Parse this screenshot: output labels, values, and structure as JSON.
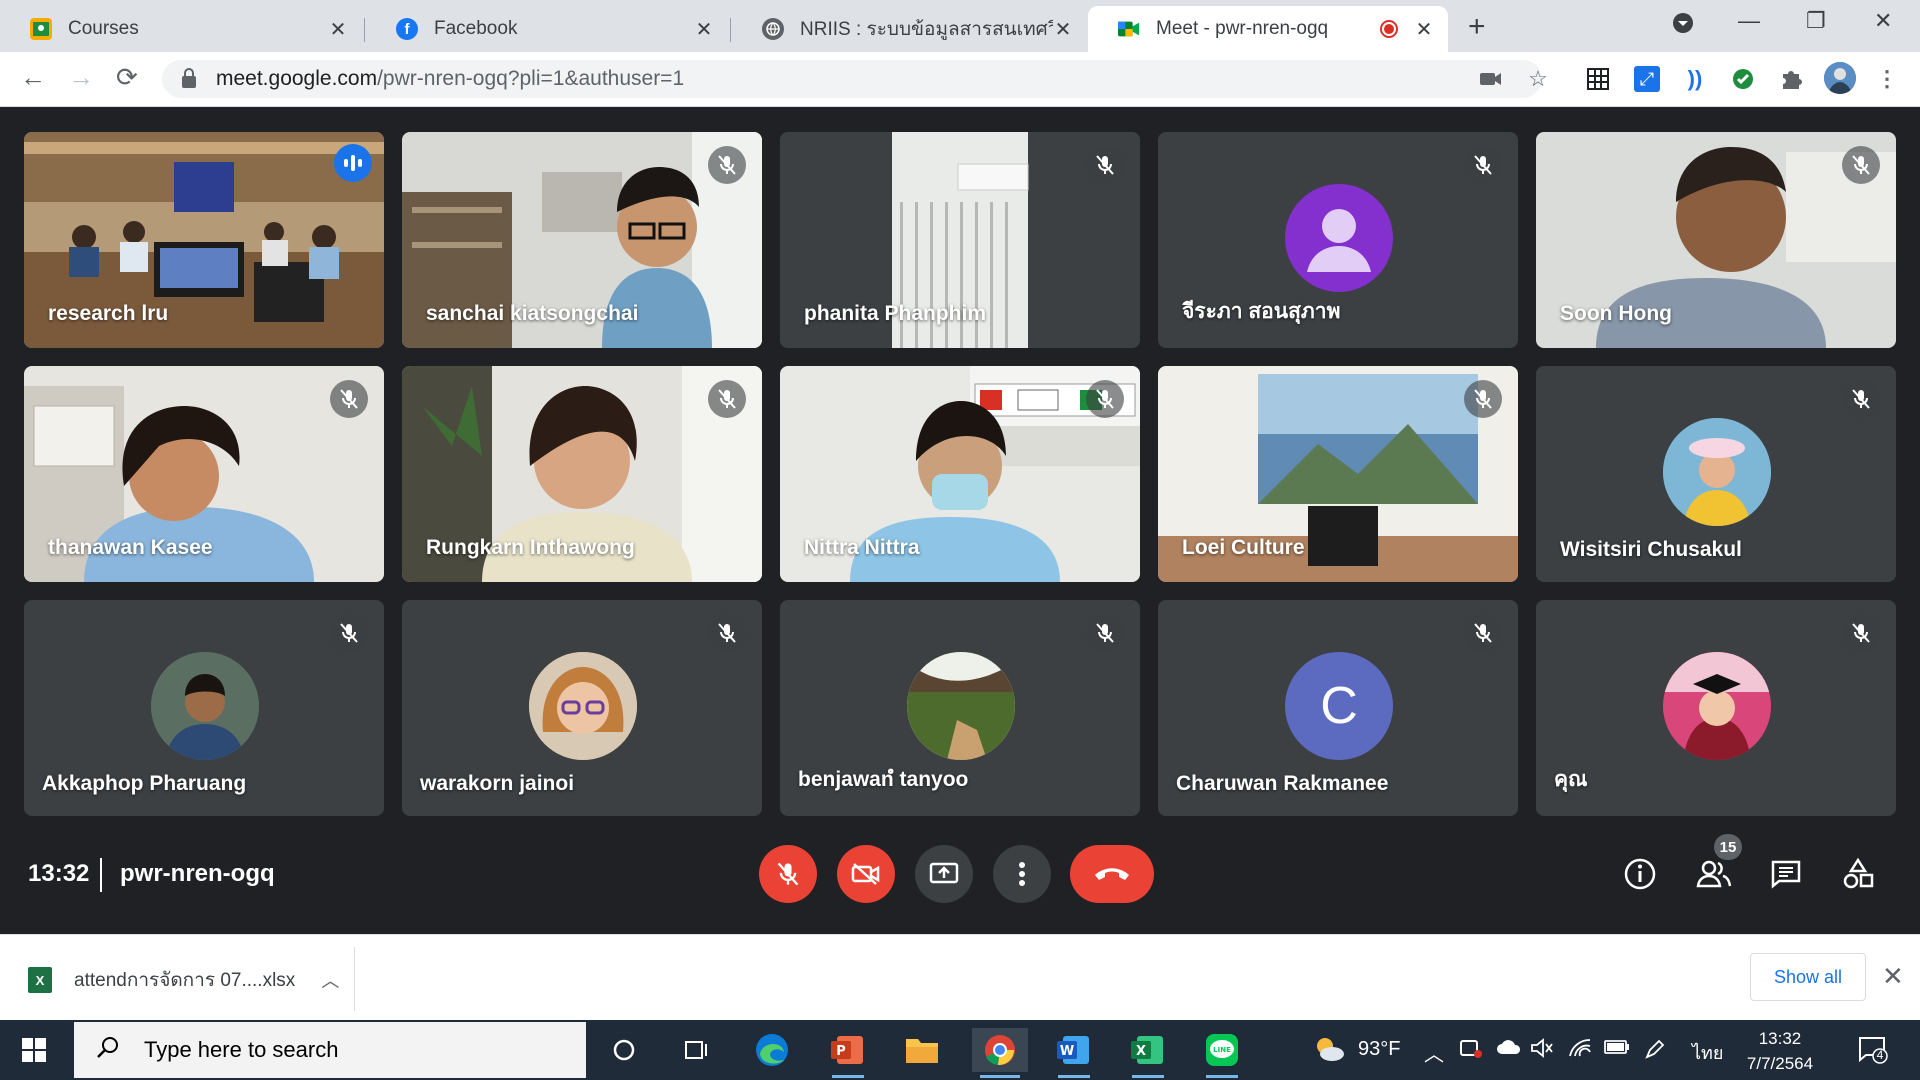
{
  "browser": {
    "tabs": [
      {
        "title": "Courses",
        "icon": "google-classroom-icon"
      },
      {
        "title": "Facebook",
        "icon": "facebook-icon"
      },
      {
        "title": "NRIIS : ระบบข้อมูลสารสนเทศวิจัยและ",
        "icon": "globe-icon"
      },
      {
        "title": "Meet - pwr-nren-ogq",
        "icon": "google-meet-icon",
        "active": true,
        "recording": true
      }
    ],
    "address": {
      "host": "meet.google.com",
      "path": "/pwr-nren-ogq?pli=1&authuser=1"
    }
  },
  "participants": [
    {
      "name": "research lru",
      "talking": true
    },
    {
      "name": "sanchai kiatsongchai",
      "muted": true
    },
    {
      "name": "phanita Phanphim",
      "muted": true
    },
    {
      "name": "จีระภา สอนสุภาพ",
      "muted": true,
      "avatar": "default-person"
    },
    {
      "name": "Soon Hong",
      "muted": true
    },
    {
      "name": "thanawan Kasee",
      "muted": true
    },
    {
      "name": "Rungkarn Inthawong",
      "muted": true
    },
    {
      "name": "Nittra Nittra",
      "muted": true
    },
    {
      "name": "Loei Culture",
      "muted": true
    },
    {
      "name": "Wisitsiri Chusakul",
      "muted": true,
      "avatar": "photo"
    },
    {
      "name": "Akkaphop Pharuang",
      "muted": true,
      "avatar": "photo"
    },
    {
      "name": "warakorn jainoi",
      "muted": true,
      "avatar": "photo"
    },
    {
      "name": "benjawanํ tanyoo",
      "muted": true,
      "avatar": "photo"
    },
    {
      "name": "Charuwan Rakmanee",
      "muted": true,
      "avatar_letter": "C"
    },
    {
      "name": "คุณ",
      "muted": true,
      "avatar": "photo"
    }
  ],
  "meeting": {
    "time": "13:32",
    "code": "pwr-nren-ogq",
    "people_count": "15"
  },
  "downloads": {
    "file_name": "attendการจัดการ 07....xlsx",
    "show_all": "Show all"
  },
  "taskbar": {
    "search_placeholder": "Type here to search",
    "weather": "93°F",
    "language": "ไทย",
    "time": "13:32",
    "date": "7/7/2564",
    "notification_count": "4"
  },
  "colors": {
    "meet_bg": "#202124",
    "tile_bg": "#3c4043",
    "danger": "#ea4335",
    "accent": "#1a73e8"
  }
}
